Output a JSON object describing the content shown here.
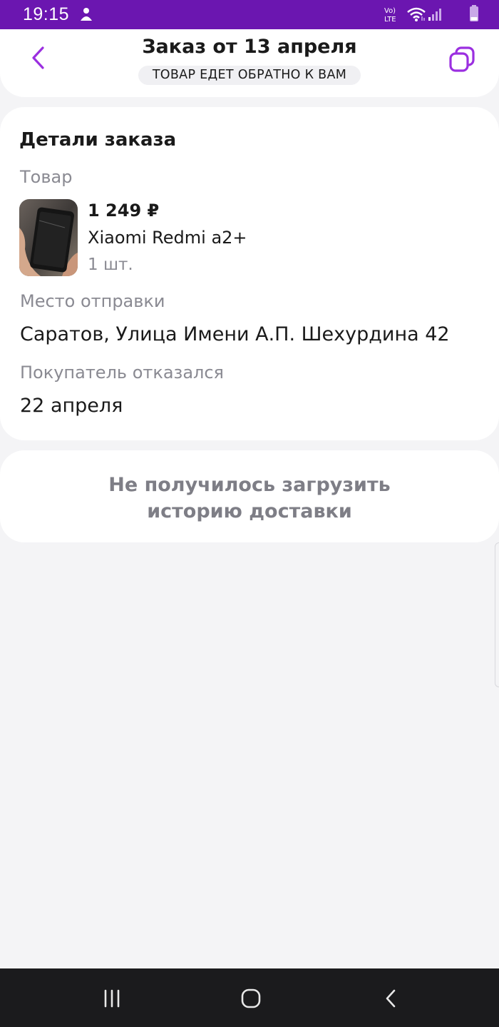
{
  "status_bar": {
    "time": "19:15",
    "network": "Vo) LTE",
    "left_icon": "notification-person-icon",
    "right_icons": [
      "volte-icon",
      "wifi-icon",
      "signal-icon",
      "battery-icon"
    ]
  },
  "header": {
    "title": "Заказ от 13 апреля",
    "status": "ТОВАР ЕДЕТ ОБРАТНО К ВАМ",
    "back_icon": "chevron-left-icon",
    "copy_icon": "copy-icon",
    "accent_color": "#9b2fe0"
  },
  "details": {
    "title": "Детали заказа",
    "product_label": "Товар",
    "product": {
      "price": "1 249 ₽",
      "name": "Xiaomi Redmi a2+",
      "quantity": "1 шт."
    },
    "departure_label": "Место отправки",
    "departure_value": "Саратов, Улица Имени А.П. Шехурдина 42",
    "refused_label": "Покупатель отказался",
    "refused_value": "22 апреля"
  },
  "history": {
    "error_line1": "Не получилось загрузить",
    "error_line2": "историю доставки"
  },
  "nav_bar": {
    "buttons": [
      "recent-apps-icon",
      "home-icon",
      "back-icon"
    ]
  },
  "colors": {
    "status_bar": "#6b16b0",
    "background": "#f4f4f6",
    "card": "#ffffff",
    "muted_text": "#8a8a92"
  }
}
